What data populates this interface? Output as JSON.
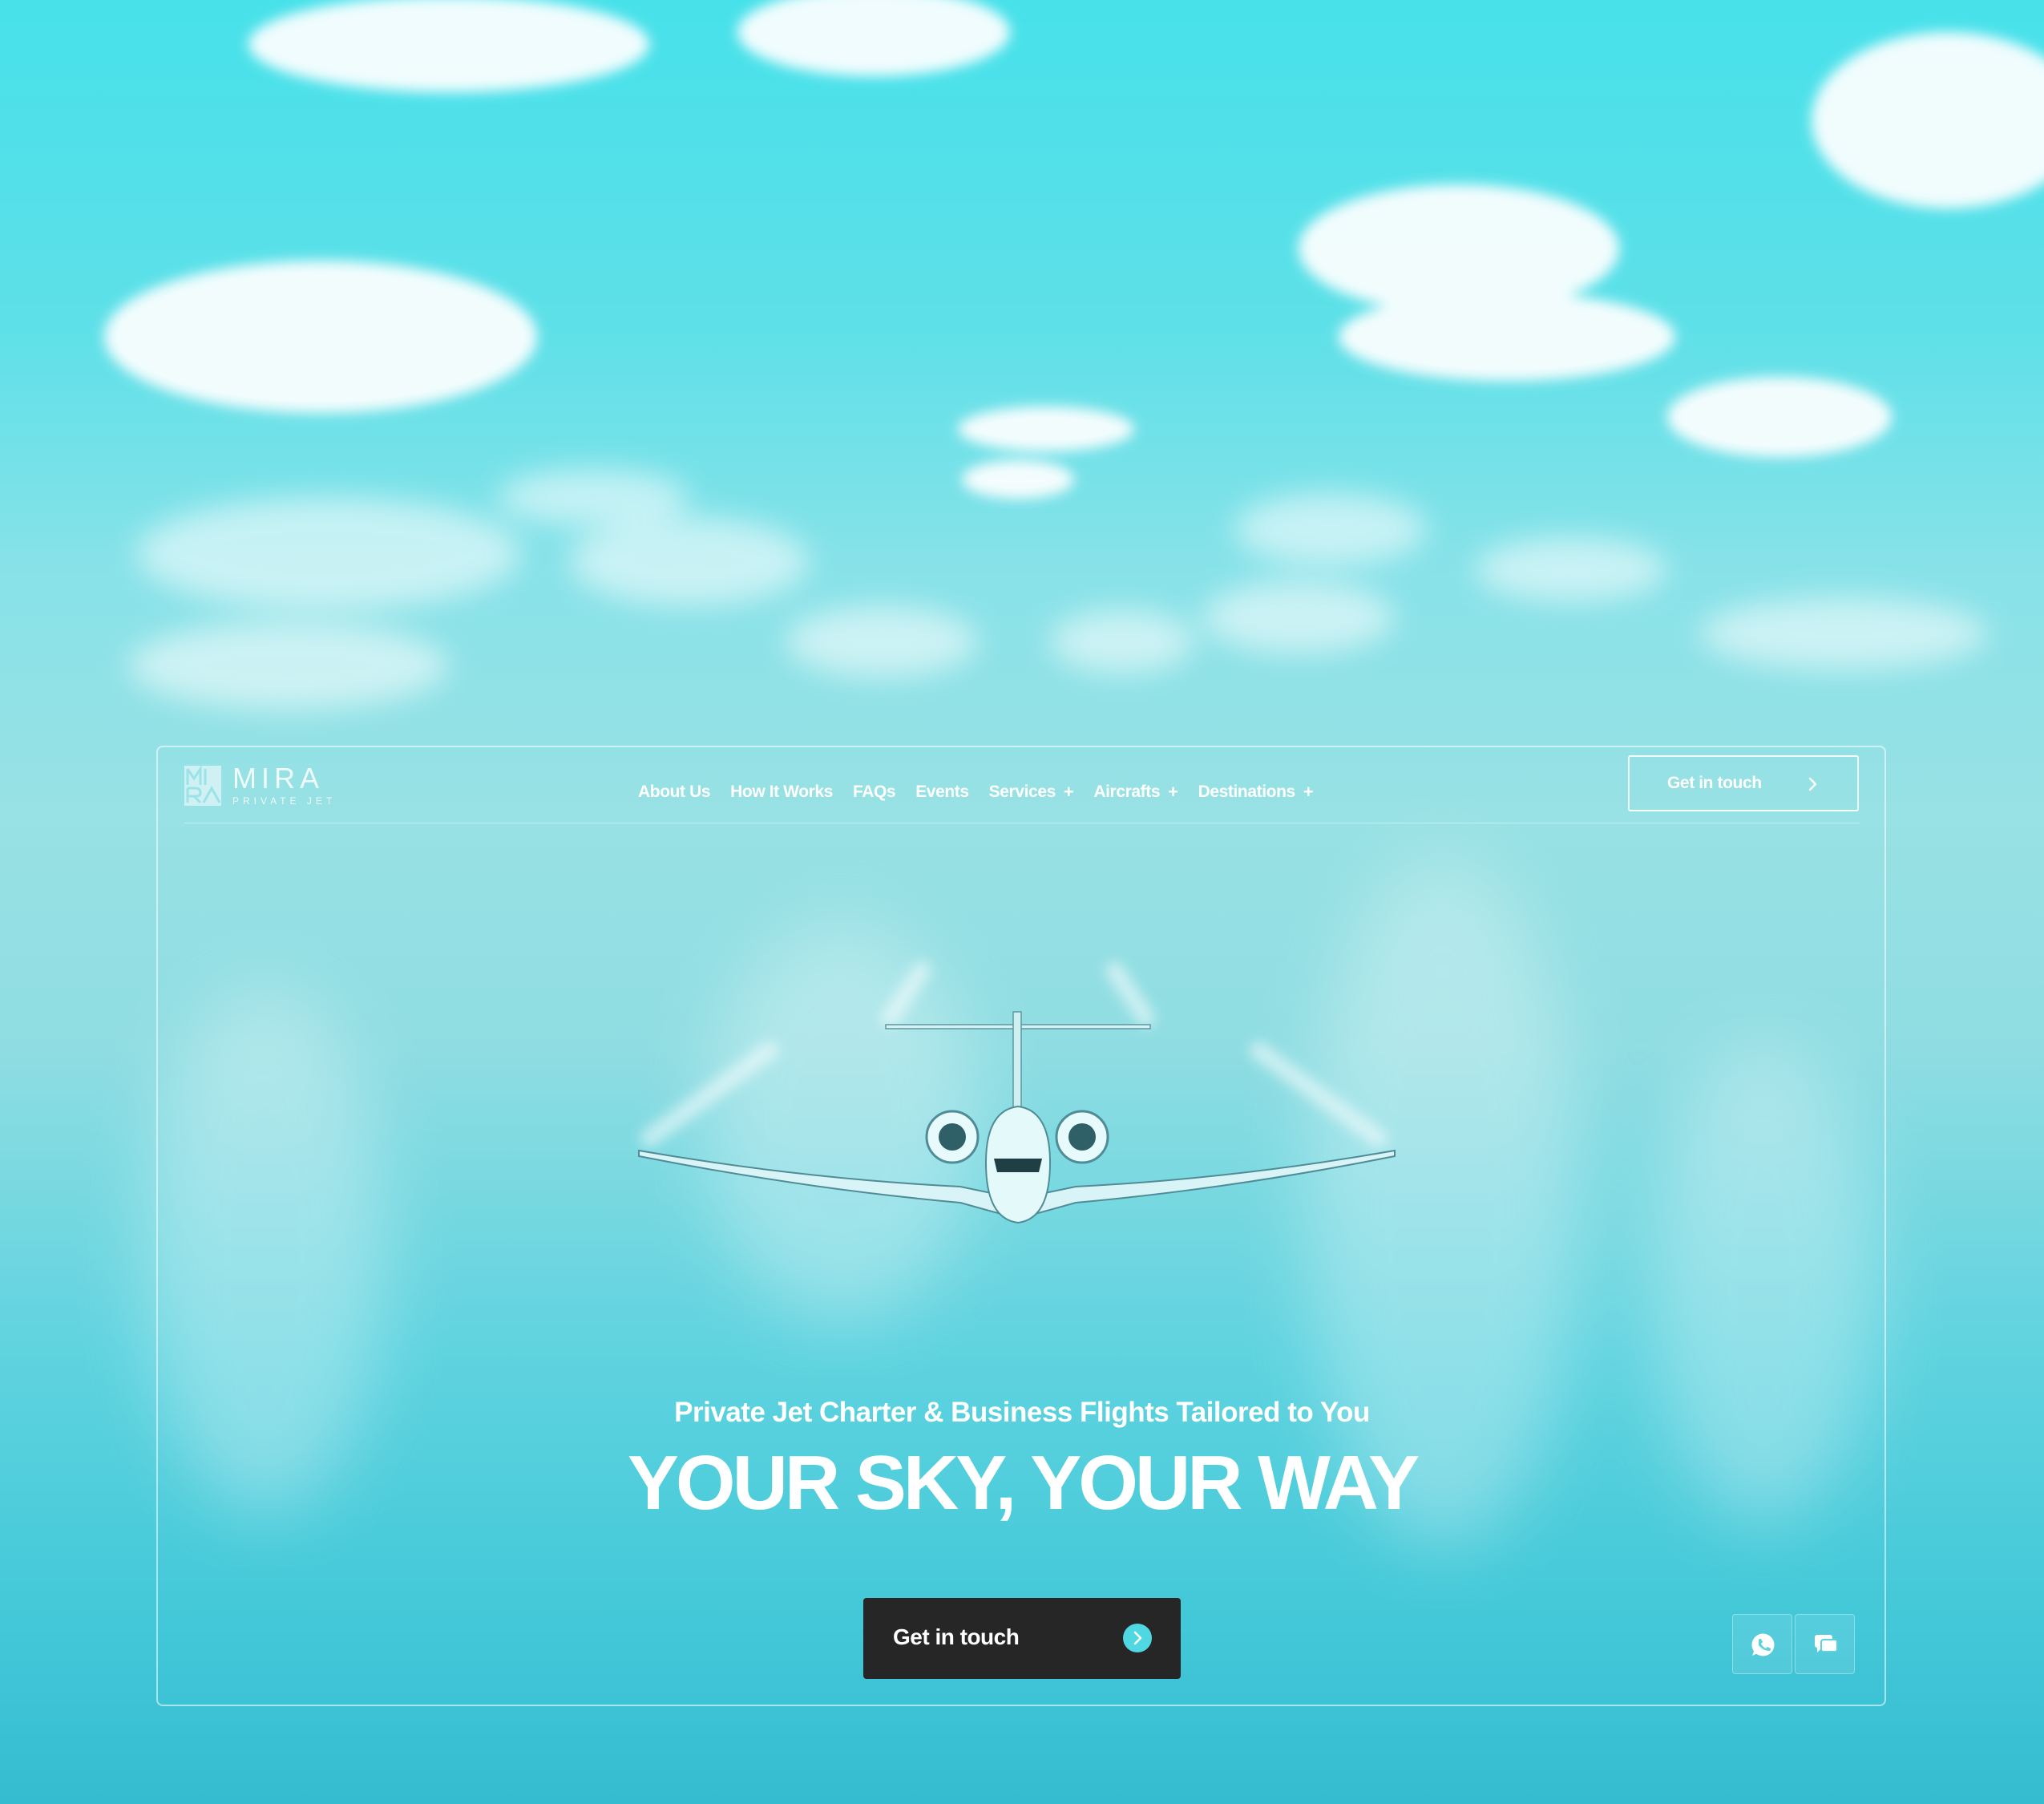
{
  "brand": {
    "name": "MIRA",
    "tagline": "PRIVATE JET",
    "accent_color": "#4fd8e2"
  },
  "nav": {
    "items": [
      {
        "label": "About Us",
        "has_submenu": false
      },
      {
        "label": "How It Works",
        "has_submenu": false
      },
      {
        "label": "FAQs",
        "has_submenu": false
      },
      {
        "label": "Events",
        "has_submenu": false
      },
      {
        "label": "Services",
        "has_submenu": true
      },
      {
        "label": "Aircrafts",
        "has_submenu": true
      },
      {
        "label": "Destinations",
        "has_submenu": true
      }
    ],
    "submenu_indicator": "+",
    "cta_label": "Get in touch"
  },
  "hero": {
    "subtitle": "Private Jet Charter & Business Flights Tailored to You",
    "title": "YOUR SKY, YOUR WAY",
    "cta_label": "Get in touch",
    "cta_background": "#262626"
  },
  "floating_actions": [
    {
      "icon": "whatsapp-icon"
    },
    {
      "icon": "chat-icon"
    }
  ]
}
